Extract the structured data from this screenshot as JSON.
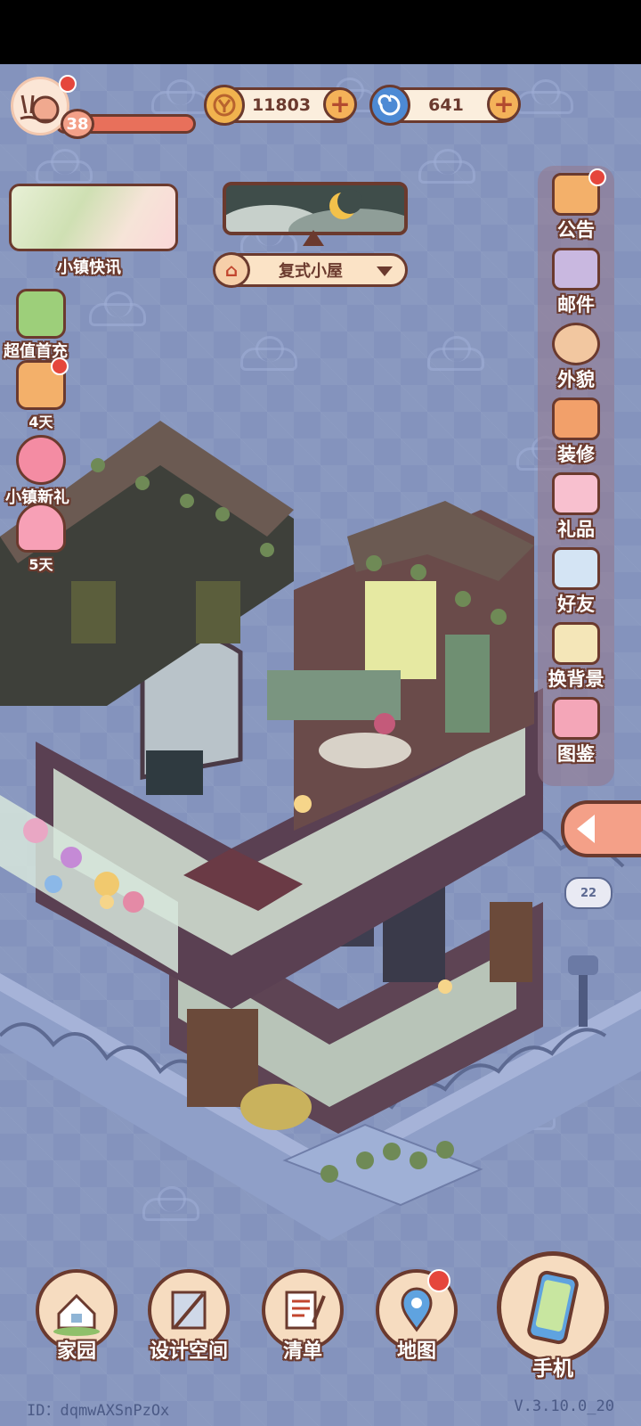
{
  "player": {
    "level": "38"
  },
  "currency": {
    "coins": "11803",
    "gems": "641"
  },
  "news": {
    "label": "小镇快讯"
  },
  "house": {
    "name": "复式小屋"
  },
  "promos": [
    {
      "label": "超值首充"
    },
    {
      "label": "4天"
    },
    {
      "label": "小镇新礼"
    },
    {
      "label": "5天"
    }
  ],
  "right_menu": [
    {
      "label": "公告"
    },
    {
      "label": "邮件"
    },
    {
      "label": "外貌"
    },
    {
      "label": "装修"
    },
    {
      "label": "礼品"
    },
    {
      "label": "好友"
    },
    {
      "label": "换背景"
    },
    {
      "label": "图鉴"
    }
  ],
  "bubble": {
    "count": "22"
  },
  "bottom_nav": [
    {
      "label": "家园"
    },
    {
      "label": "设计空间"
    },
    {
      "label": "清单"
    },
    {
      "label": "地图"
    },
    {
      "label": "手机"
    }
  ],
  "footer": {
    "id": "ID：dqmwAXSnPzOx",
    "version": "V.3.10.0_20"
  },
  "colors": {
    "outline": "#6b3a2e",
    "accent": "#f4a088",
    "background": "#8493bd",
    "notification": "#e5463c"
  }
}
